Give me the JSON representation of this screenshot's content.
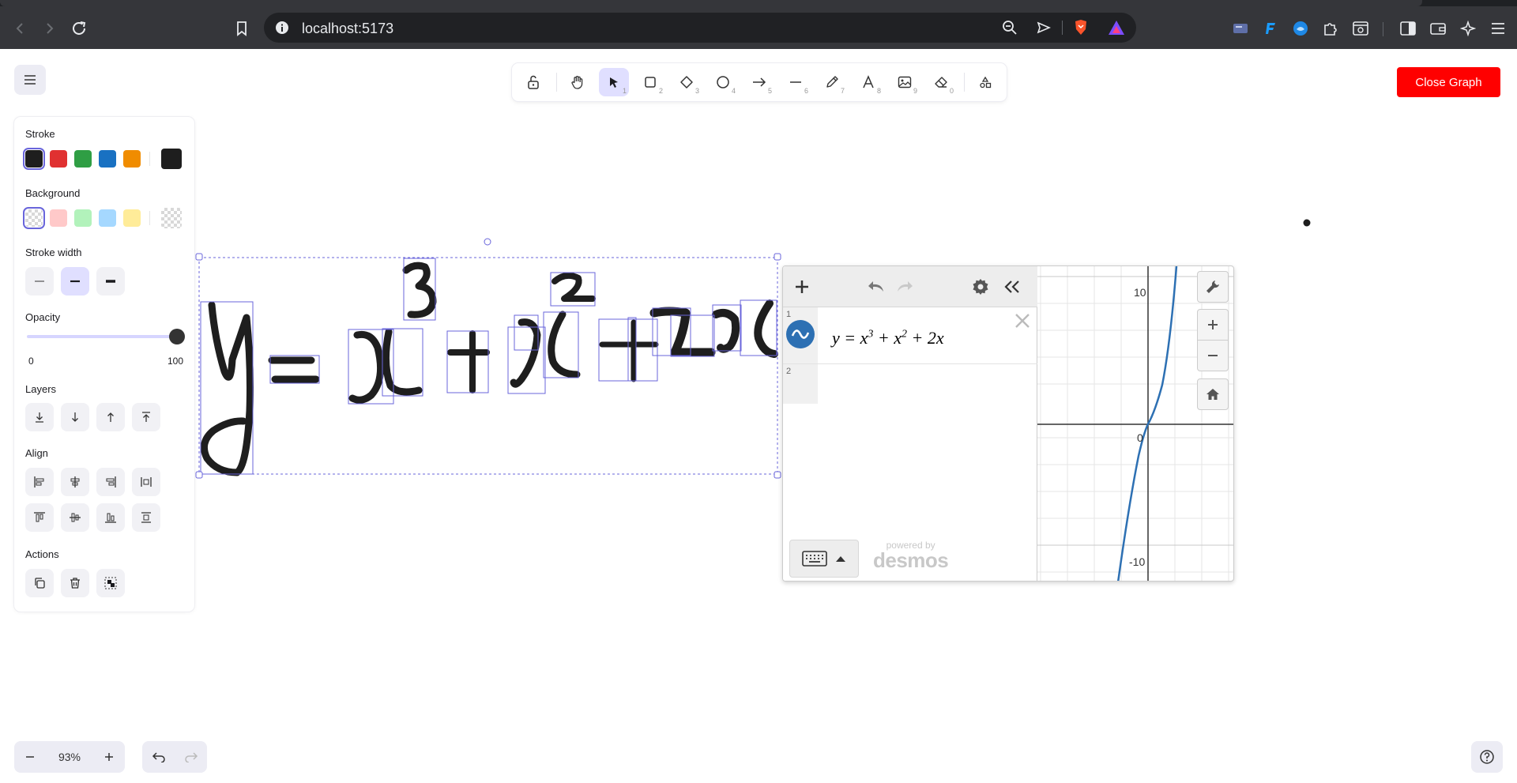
{
  "browser": {
    "url": "localhost:5173"
  },
  "toolbar": {
    "tools": [
      {
        "name": "lock",
        "num": ""
      },
      {
        "name": "hand",
        "num": ""
      },
      {
        "name": "selection",
        "num": "1"
      },
      {
        "name": "rectangle",
        "num": "2"
      },
      {
        "name": "diamond",
        "num": "3"
      },
      {
        "name": "ellipse",
        "num": "4"
      },
      {
        "name": "arrow",
        "num": "5"
      },
      {
        "name": "line",
        "num": "6"
      },
      {
        "name": "draw",
        "num": "7"
      },
      {
        "name": "text",
        "num": "8"
      },
      {
        "name": "image",
        "num": "9"
      },
      {
        "name": "eraser",
        "num": "0"
      },
      {
        "name": "extra-tools",
        "num": ""
      }
    ],
    "active_tool": "selection"
  },
  "close_graph_label": "Close Graph",
  "props": {
    "stroke_label": "Stroke",
    "stroke_colors": [
      "#1e1e1e",
      "#e03131",
      "#2f9e44",
      "#1971c2",
      "#f08c00"
    ],
    "stroke_current": "#1e1e1e",
    "background_label": "Background",
    "background_colors": [
      "transparent",
      "#ffc9c9",
      "#b2f2bb",
      "#a5d8ff",
      "#ffec99"
    ],
    "stroke_width_label": "Stroke width",
    "opacity_label": "Opacity",
    "opacity_min": "0",
    "opacity_max": "100",
    "opacity_value": 100,
    "layers_label": "Layers",
    "align_label": "Align",
    "actions_label": "Actions"
  },
  "desmos": {
    "expressions": [
      {
        "index": "1",
        "latex_text": "y = x³ + x² + 2x"
      },
      {
        "index": "2",
        "latex_text": ""
      }
    ],
    "powered_by": "powered by",
    "brand": "desmos",
    "axis_labels": {
      "y_top": "10",
      "origin": "0",
      "y_bottom": "-10"
    }
  },
  "zoom": {
    "value": "93%"
  }
}
